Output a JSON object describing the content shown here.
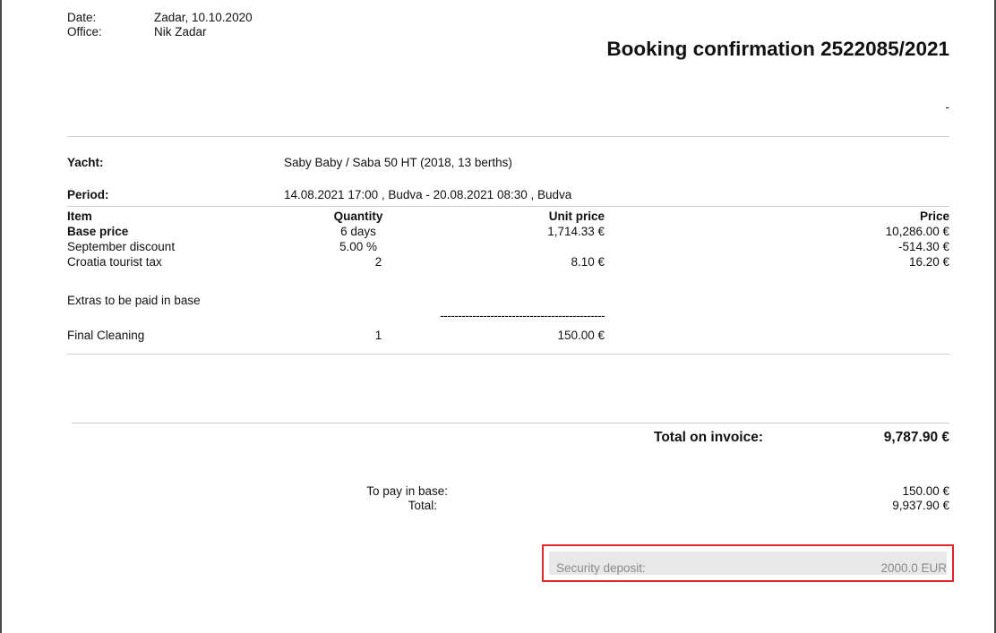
{
  "header": {
    "date_label": "Date:",
    "date_value": "Zadar, 10.10.2020",
    "office_label": "Office:",
    "office_value": "Nik Zadar",
    "title": "Booking confirmation 2522085/2021",
    "dash": "-"
  },
  "details": {
    "yacht_label": "Yacht:",
    "yacht_value": "Saby Baby / Saba 50 HT (2018, 13 berths)",
    "period_label": "Period:",
    "period_value": "14.08.2021 17:00 , Budva - 20.08.2021 08:30 , Budva"
  },
  "table": {
    "headers": {
      "item": "Item",
      "quantity": "Quantity",
      "unit_price": "Unit price",
      "price": "Price"
    },
    "rows": [
      {
        "item": "Base price",
        "quantity": "6 days",
        "unit_price": "1,714.33 €",
        "price": "10,286.00 €"
      },
      {
        "item": "September discount",
        "quantity": "5.00 %",
        "unit_price": "",
        "price": "-514.30 €"
      },
      {
        "item": "Croatia tourist tax",
        "quantity": "2",
        "unit_price": "8.10 €",
        "price": "16.20 €"
      }
    ],
    "extras_heading": "Extras to be paid in base",
    "separator": "----------------------------------------------",
    "extras": [
      {
        "item": "Final Cleaning",
        "quantity": "1",
        "unit_price": "150.00 €"
      }
    ]
  },
  "totals": {
    "invoice_label": "Total on invoice:",
    "invoice_value": "9,787.90 €",
    "pay_in_base_label": "To pay in base:",
    "pay_in_base_value": "150.00 €",
    "total_label": "Total:",
    "total_value": "9,937.90 €"
  },
  "deposit": {
    "label": "Security deposit:",
    "value": "2000.0 EUR",
    "highlight_color": "#e0262a"
  }
}
